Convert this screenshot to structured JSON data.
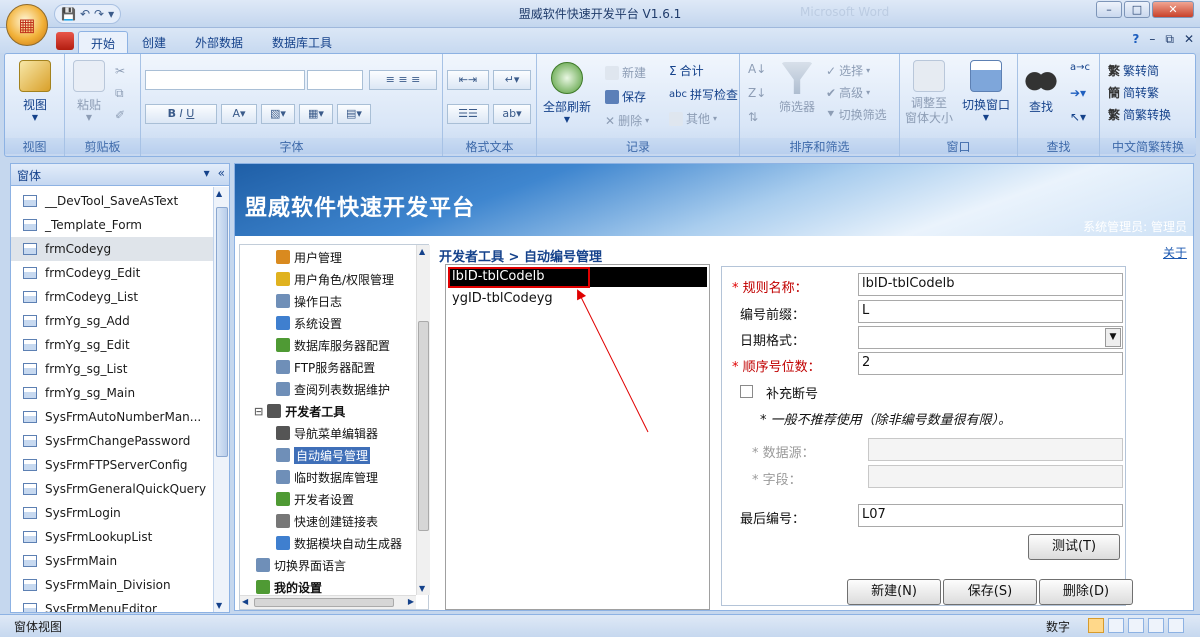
{
  "window": {
    "title": "盟威软件快速开发平台 V1.6.1",
    "ghost_title": "Microsoft Word"
  },
  "ribbon_tabs": [
    "开始",
    "创建",
    "外部数据",
    "数据库工具"
  ],
  "ribbon": {
    "view": {
      "btn": "视图",
      "group": "视图"
    },
    "clipboard": {
      "paste": "粘贴",
      "group": "剪贴板"
    },
    "font": {
      "group": "字体"
    },
    "richtext": {
      "group": "格式文本"
    },
    "records": {
      "refresh_all": "全部刷新",
      "new": "新建",
      "save": "保存",
      "delete": "删除",
      "totals": "合计",
      "spelling": "拼写检查",
      "more": "其他",
      "group": "记录"
    },
    "sort": {
      "filter": "筛选器",
      "selection": "选择",
      "advanced": "高级",
      "toggle": "切换筛选",
      "group": "排序和筛选"
    },
    "window": {
      "fit": "调整至\n窗体大小",
      "switch": "切换窗口",
      "group": "窗口"
    },
    "find": {
      "find": "查找",
      "group": "查找"
    },
    "convert": {
      "t2s": "繁转简",
      "s2t": "简转繁",
      "convert": "简繁转换",
      "group": "中文简繁转换"
    }
  },
  "nav": {
    "header": "窗体",
    "items": [
      "__DevTool_SaveAsText",
      "_Template_Form",
      "frmCodeyg",
      "frmCodeyg_Edit",
      "frmCodeyg_List",
      "frmYg_sg_Add",
      "frmYg_sg_Edit",
      "frmYg_sg_List",
      "frmYg_sg_Main",
      "SysFrmAutoNumberMan...",
      "SysFrmChangePassword",
      "SysFrmFTPServerConfig",
      "SysFrmGeneralQuickQuery",
      "SysFrmLogin",
      "SysFrmLookupList",
      "SysFrmMain",
      "SysFrmMain_Division",
      "SysFrmMenuEditor"
    ],
    "selected": "frmCodeyg"
  },
  "banner": {
    "title": "盟威软件快速开发平台",
    "user": "系统管理员: 管理员"
  },
  "tree": {
    "items": [
      {
        "label": "用户管理",
        "color": "#d98a1f"
      },
      {
        "label": "用户角色/权限管理",
        "color": "#e0b21f"
      },
      {
        "label": "操作日志",
        "color": "#6f8fb8"
      },
      {
        "label": "系统设置",
        "color": "#3f7fcf"
      },
      {
        "label": "数据库服务器配置",
        "color": "#4f9a34"
      },
      {
        "label": "FTP服务器配置",
        "color": "#6f8fb8"
      },
      {
        "label": "查阅列表数据维护",
        "color": "#6f8fb8"
      },
      {
        "label": "开发者工具",
        "color": "#555555"
      },
      {
        "label": "导航菜单编辑器",
        "color": "#555555"
      },
      {
        "label": "自动编号管理",
        "color": "#6f8fb8"
      },
      {
        "label": "临时数据库管理",
        "color": "#6f8fb8"
      },
      {
        "label": "开发者设置",
        "color": "#4f9a34"
      },
      {
        "label": "快速创建链接表",
        "color": "#777777"
      },
      {
        "label": "数据模块自动生成器",
        "color": "#3f7fcf"
      },
      {
        "label": "切换界面语言",
        "color": "#6f8fb8"
      },
      {
        "label": "我的设置",
        "color": "#4f9a34"
      }
    ],
    "selected": "自动编号管理"
  },
  "breadcrumb": "开发者工具 > 自动编号管理",
  "about": "关于",
  "rules": [
    "lbID-tblCodelb",
    "ygID-tblCodeyg"
  ],
  "form": {
    "rule_name_label": "规则名称：",
    "rule_name": "lbID-tblCodelb",
    "prefix_label": "编号前缀：",
    "prefix": "L",
    "date_format_label": "日期格式：",
    "date_format": "",
    "seq_digits_label": "顺序号位数：",
    "seq_digits": "2",
    "fill_gaps_label": "补充断号",
    "note": "* 一般不推荐使用（除非编号数量很有限）。",
    "datasource_label": "* 数据源：",
    "field_label": "* 字段：",
    "last_no_label": "最后编号：",
    "last_no": "L07",
    "test_btn": "测试(T)",
    "new_btn": "新建(N)",
    "save_btn": "保存(S)",
    "delete_btn": "删除(D)"
  },
  "status": {
    "left": "窗体视图",
    "mode": "数字"
  }
}
